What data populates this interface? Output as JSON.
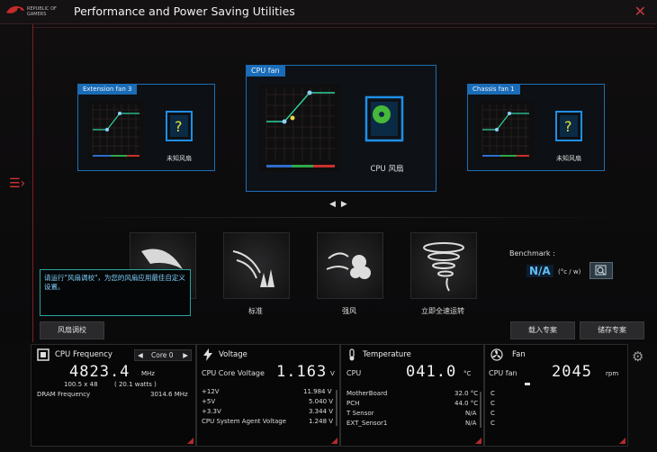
{
  "app": {
    "logo_text": "REPUBLIC OF GAMERS",
    "title": "Performance and Power Saving Utilities",
    "close": "✕"
  },
  "fans": {
    "left": {
      "header": "Extension fan 3",
      "label": "未知风扇"
    },
    "center": {
      "header": "CPU fan",
      "label": "CPU 风扇"
    },
    "right": {
      "header": "Chassis fan 1",
      "label": "未知风扇"
    }
  },
  "carousel": {
    "prev": "◀",
    "next": "▶"
  },
  "modes": {
    "standard": "标准",
    "turbo": "强风",
    "full": "立即全速运转"
  },
  "tooltip": "请运行\"风扇调校\"，为您的风扇应用最佳自定义设置。",
  "buttons": {
    "fan_tuning": "风扇调校",
    "load_profile": "载入专案",
    "save_profile": "储存专案"
  },
  "benchmark": {
    "title": "Benchmark :",
    "value": "N/A",
    "unit": "(°c / w)"
  },
  "cpu": {
    "title": "CPU Frequency",
    "core_select": "Core 0",
    "freq": "4823.4",
    "freq_unit": "MHz",
    "ratio": "100.5  x  48",
    "watts": "( 20.1 watts )",
    "dram_label": "DRAM Frequency",
    "dram_value": "3014.6  MHz"
  },
  "voltage": {
    "title": "Voltage",
    "core_label": "CPU Core Voltage",
    "core_value": "1.163",
    "core_unit": "V",
    "rows": [
      {
        "label": "+12V",
        "value": "11.984  V"
      },
      {
        "label": "+5V",
        "value": "5.040  V"
      },
      {
        "label": "+3.3V",
        "value": "3.344  V"
      },
      {
        "label": "CPU System Agent Voltage",
        "value": "1.248  V"
      }
    ]
  },
  "temperature": {
    "title": "Temperature",
    "cpu_label": "CPU",
    "cpu_value": "041.0",
    "cpu_unit": "°C",
    "rows": [
      {
        "label": "MotherBoard",
        "value": "32.0 °C"
      },
      {
        "label": "PCH",
        "value": "44.0 °C"
      },
      {
        "label": "T Sensor",
        "value": "N/A"
      },
      {
        "label": "EXT_Sensor1",
        "value": "N/A"
      }
    ]
  },
  "fan_panel": {
    "title": "Fan",
    "cpu_label": "CPU fan",
    "cpu_value": "2045",
    "cpu_unit": "rpm",
    "rows": [
      "C",
      "C",
      "C",
      "C"
    ]
  }
}
